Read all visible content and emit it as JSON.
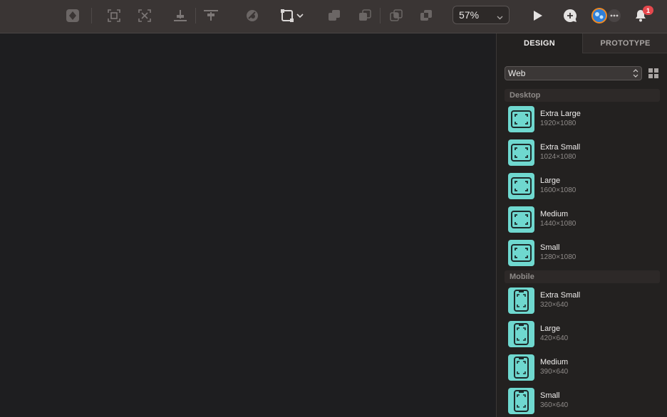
{
  "toolbar": {
    "icons": [
      "component-icon",
      "frame-selection-icon",
      "group-selection-icon",
      "distribute-horizontal-icon",
      "distribute-vertical-icon",
      "mask-icon",
      "transform-icon",
      "union-icon",
      "subtract-icon",
      "intersect-icon",
      "difference-icon",
      "play-icon",
      "comment-icon",
      "avatar",
      "more-icon",
      "notifications-icon"
    ],
    "zoom": "57%",
    "notification_count": "1"
  },
  "panel": {
    "tabs": [
      "DESIGN",
      "PROTOTYPE"
    ],
    "active_tab": "DESIGN",
    "device_type": "Web",
    "sections": [
      {
        "title": "Desktop",
        "items": [
          {
            "name": "Extra Large",
            "size": "1920×1080"
          },
          {
            "name": "Extra Small",
            "size": "1024×1080"
          },
          {
            "name": "Large",
            "size": "1600×1080"
          },
          {
            "name": "Medium",
            "size": "1440×1080"
          },
          {
            "name": "Small",
            "size": "1280×1080"
          }
        ]
      },
      {
        "title": "Mobile",
        "items": [
          {
            "name": "Extra Small",
            "size": "320×640"
          },
          {
            "name": "Large",
            "size": "420×640"
          },
          {
            "name": "Medium",
            "size": "390×640"
          },
          {
            "name": "Small",
            "size": "360×640"
          }
        ]
      }
    ]
  },
  "colors": {
    "toolbar_bg": "#3a3534",
    "canvas_bg": "#1e1e20",
    "panel_bg": "#232120",
    "thumb_accent": "#6fd8cf",
    "badge": "#e5484d"
  }
}
